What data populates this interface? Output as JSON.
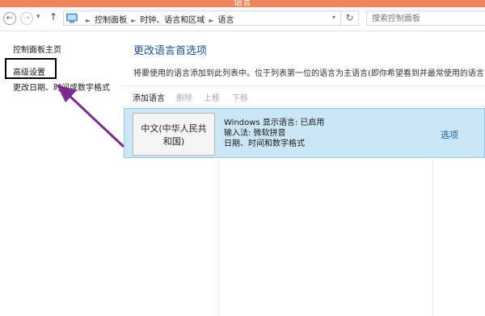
{
  "window": {
    "title": "语言",
    "title_bar_color": "#f0855a"
  },
  "navigation": {
    "back_icon": "arrow-left-icon",
    "forward_icon": "arrow-right-icon",
    "up_icon": "arrow-up-icon",
    "recent_icon": "chevron-down-icon",
    "address_icon": "control-panel-icon",
    "breadcrumbs": [
      "控制面板",
      "时钟、语言和区域",
      "语言"
    ],
    "refresh_icon": "refresh-icon",
    "search_placeholder": "搜索控制面板"
  },
  "sidebar": {
    "items": [
      {
        "label": "控制面板主页"
      },
      {
        "label": "高级设置"
      },
      {
        "label": "更改日期、时间或数字格式"
      }
    ]
  },
  "main": {
    "title": "更改语言首选项",
    "description": "将要使用的语言添加到此列表中。位于列表第一位的语言为主语言(即你希望看到并最常使用的语言)。",
    "toolbar": {
      "add": "添加语言",
      "remove": "删除",
      "move_up": "上移",
      "move_down": "下移"
    },
    "languages": [
      {
        "name_line1": "中文(中华人民共",
        "name_line2": "和国)",
        "display_language": "Windows 显示语言: 已启用",
        "input_method": "输入法: 微软拼音",
        "formats": "日期、时间和数字格式",
        "options_label": "选项"
      }
    ]
  },
  "colors": {
    "accent_link": "#1e4e8c",
    "selected_row": "#cbe6f7",
    "annotation_arrow": "#7b2a8f"
  }
}
